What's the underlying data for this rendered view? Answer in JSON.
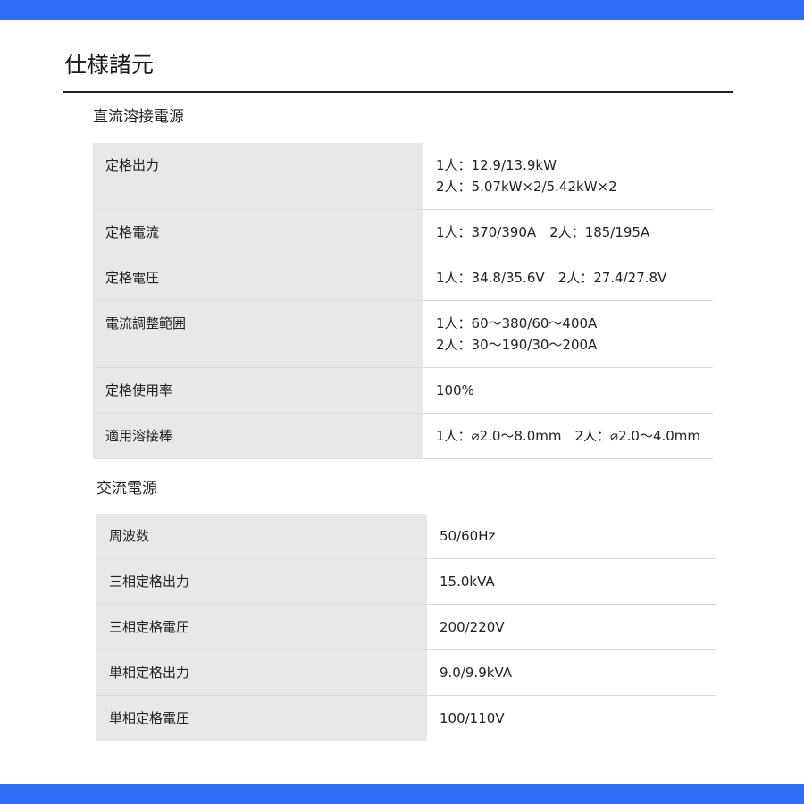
{
  "page": {
    "title": "仕様諸元"
  },
  "accent_color": "#2e6df6",
  "dc_section": {
    "heading": "直流溶接電源",
    "rows": [
      {
        "label": "定格出力",
        "lines": [
          "1人：12.9/13.9kW",
          "2人：5.07kW×2/5.42kW×2"
        ]
      },
      {
        "label": "定格電流",
        "lines": [
          "1人：370/390A　2人：185/195A"
        ]
      },
      {
        "label": "定格電圧",
        "lines": [
          "1人：34.8/35.6V　2人：27.4/27.8V"
        ]
      },
      {
        "label": "電流調整範囲",
        "lines": [
          "1人：60～380/60～400A",
          "2人：30～190/30～200A"
        ]
      },
      {
        "label": "定格使用率",
        "lines": [
          "100%"
        ]
      },
      {
        "label": "適用溶接棒",
        "lines": [
          "1人：⌀2.0～8.0mm　2人：⌀2.0～4.0mm"
        ]
      }
    ]
  },
  "ac_section": {
    "heading": "交流電源",
    "rows": [
      {
        "label": "周波数",
        "lines": [
          "50/60Hz"
        ]
      },
      {
        "label": "三相定格出力",
        "lines": [
          "15.0kVA"
        ]
      },
      {
        "label": "三相定格電圧",
        "lines": [
          "200/220V"
        ]
      },
      {
        "label": "単相定格出力",
        "lines": [
          "9.0/9.9kVA"
        ]
      },
      {
        "label": "単相定格電圧",
        "lines": [
          "100/110V"
        ]
      }
    ]
  }
}
